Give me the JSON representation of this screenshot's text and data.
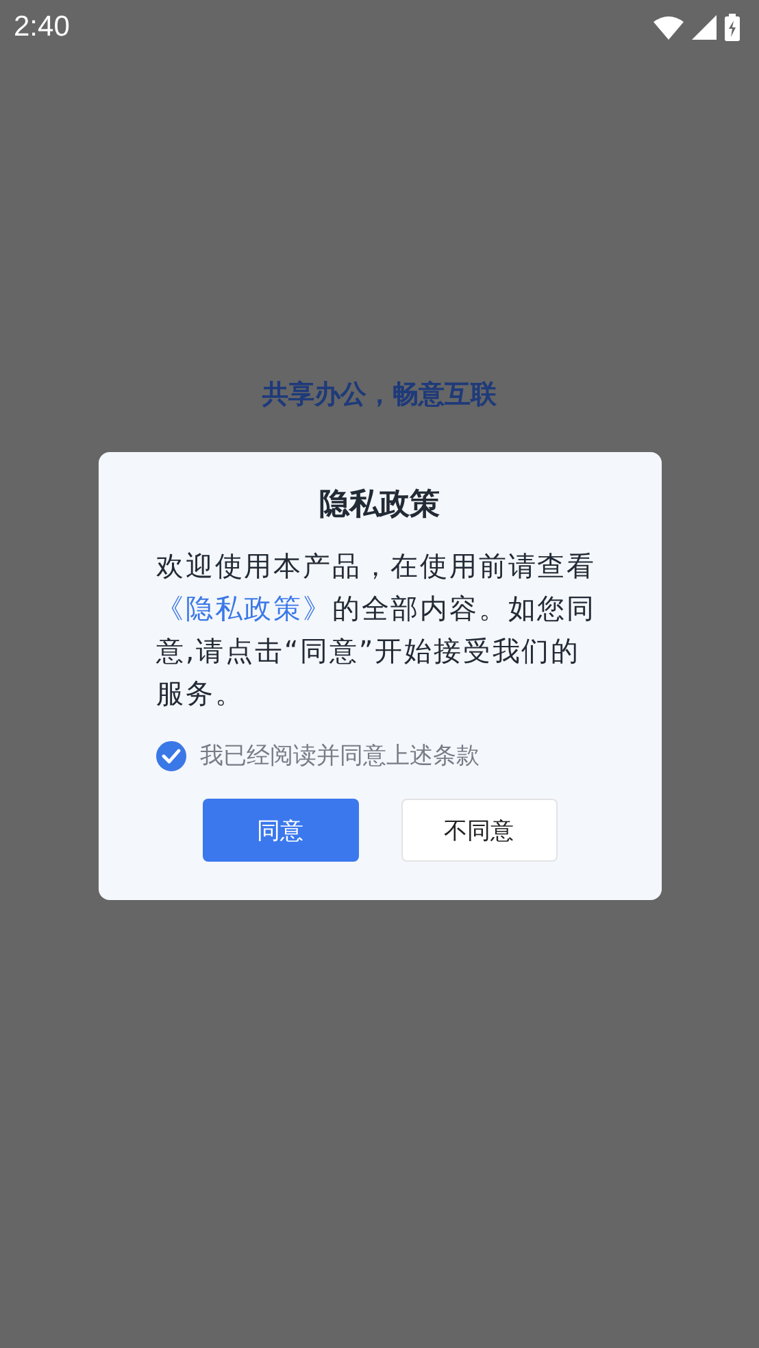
{
  "status_bar": {
    "time": "2:40"
  },
  "slogan": "共享办公，畅意互联",
  "dialog": {
    "title": "隐私政策",
    "message": {
      "before": "欢迎使用本产品，在使用前请查看",
      "link": "《隐私政策》",
      "after": "的全部内容。如您同意,请点击“同意”开始接受我们的服务。"
    },
    "consent": {
      "label": "我已经阅读并同意上述条款",
      "checked": true
    },
    "buttons": [
      {
        "label": "同意",
        "kind": "primary"
      },
      {
        "label": "不同意",
        "kind": "secondary"
      }
    ]
  }
}
